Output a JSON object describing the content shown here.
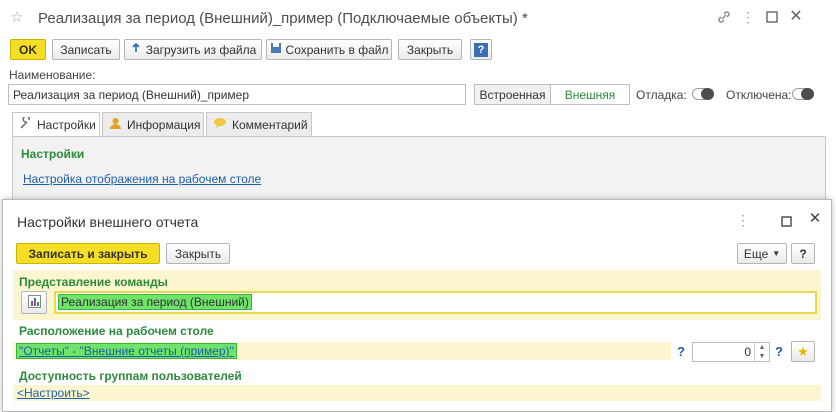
{
  "main": {
    "title": "Реализация за период (Внешний)_пример (Подключаемые объекты) *",
    "toolbar": {
      "ok": "OK",
      "save": "Записать",
      "load_from_file": "Загрузить из файла",
      "save_to_file": "Сохранить в файл",
      "close": "Закрыть",
      "help": "?"
    },
    "name_label": "Наименование:",
    "name_value": "Реализация за период (Внешний)_пример",
    "type_options": [
      "Встроенная",
      "Внешняя"
    ],
    "type_selected": "Внешняя",
    "debug_label": "Отладка:",
    "disabled_label": "Отключена:",
    "tabs": [
      {
        "label": "Настройки",
        "icon": "wrench-icon"
      },
      {
        "label": "Информация",
        "icon": "info-person-icon"
      },
      {
        "label": "Комментарий",
        "icon": "comment-icon"
      }
    ],
    "settings_heading": "Настройки",
    "settings_link": "Настройка отображения на рабочем столе"
  },
  "modal": {
    "title": "Настройки внешнего отчета",
    "save_close": "Записать и закрыть",
    "close": "Закрыть",
    "more": "Еще",
    "help": "?",
    "command_heading": "Представление команды",
    "command_value": "Реализация за период (Внешний)",
    "location_heading": "Расположение на рабочем столе",
    "location_link": "\"Отчеты\" - \"Внешние отчеты (пример)\"",
    "location_help": "?",
    "order_value": "0",
    "access_heading": "Доступность группам пользователей",
    "access_link": "<Настроить>"
  },
  "colors": {
    "accent_yellow": "#f6de26",
    "heading_green": "#2c8a3b",
    "link_blue": "#1f5da8",
    "highlight_green": "#6fe36a"
  }
}
